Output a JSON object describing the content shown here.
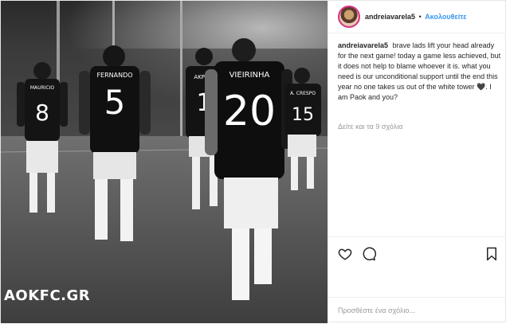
{
  "post": {
    "username": "andreiavarela5",
    "separator": "•",
    "follow_label": "Ακολουθείτε",
    "caption": "brave lads lift your head already for the next game! today a game less achieved, but it does not help to blame whoever it is. what you need is our unconditional support until the end this year no one takes us out of the white tower 🖤. I am Paok and you?",
    "view_comments_label": "Δείτε και τα 9 σχόλια",
    "comment_placeholder": "Προσθέστε ένα σχόλιο..."
  },
  "photo": {
    "watermark": "AOKFC.GR",
    "jerseys": [
      {
        "name": "MAURICIO",
        "number": "8"
      },
      {
        "name": "FERNANDO",
        "number": "5"
      },
      {
        "name": "AKPOM",
        "number": "1"
      },
      {
        "name": "VIEIRINHA",
        "number": "20"
      },
      {
        "name": "A. CRESPO",
        "number": "15"
      }
    ]
  },
  "icons": {
    "like": "heart-icon",
    "comment": "comment-icon",
    "save": "bookmark-icon"
  }
}
